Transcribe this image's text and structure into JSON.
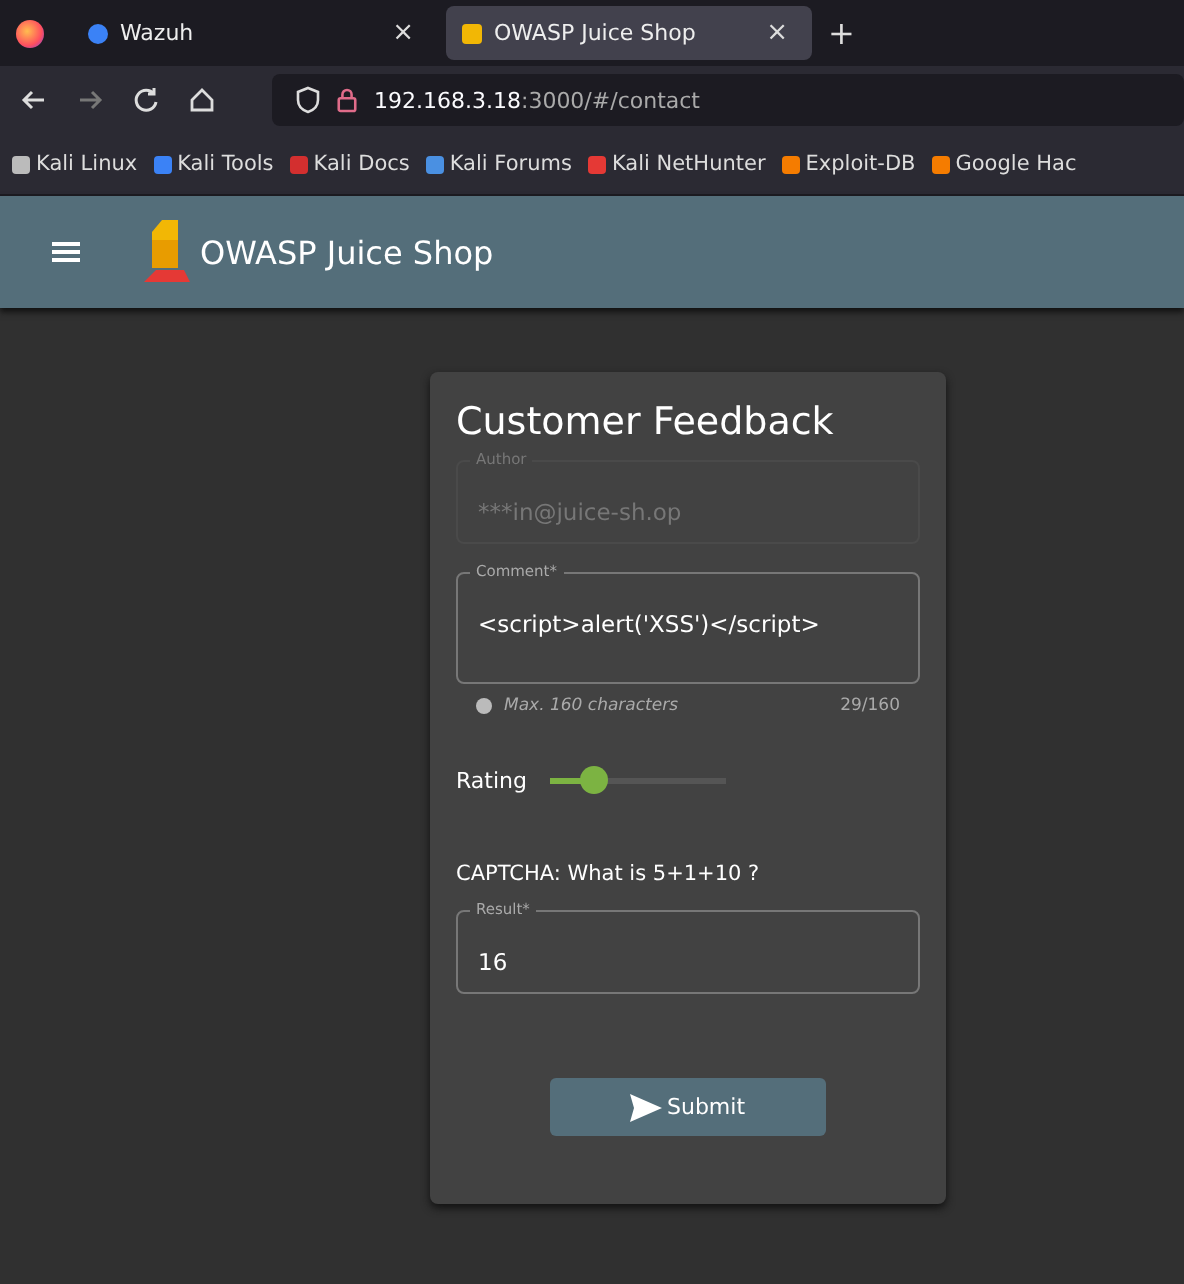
{
  "browser": {
    "tabs": [
      {
        "title": "Wazuh",
        "selected": false,
        "close": "×"
      },
      {
        "title": "OWASP Juice Shop",
        "selected": true,
        "close": "×"
      }
    ],
    "new_tab": "+",
    "address": {
      "host": "192.168.3.18",
      "path": ":3000/#/contact"
    },
    "bookmarks": [
      "Kali Linux",
      "Kali Tools",
      "Kali Docs",
      "Kali Forums",
      "Kali NetHunter",
      "Exploit-DB",
      "Google Hac"
    ]
  },
  "app_bar": {
    "title": "OWASP Juice Shop"
  },
  "form": {
    "title": "Customer Feedback",
    "author": {
      "label": "Author",
      "value": "***in@juice-sh.op",
      "disabled": true
    },
    "comment": {
      "label": "Comment*",
      "value": "<script>alert('XSS')</script>",
      "hint": "Max. 160 characters",
      "count": "29/160"
    },
    "rating": {
      "label": "Rating",
      "level": 0.25
    },
    "captcha": {
      "question": "CAPTCHA:  What is  5+1+10 ?",
      "label": "Result*",
      "value": "16"
    },
    "submit": "Submit"
  }
}
